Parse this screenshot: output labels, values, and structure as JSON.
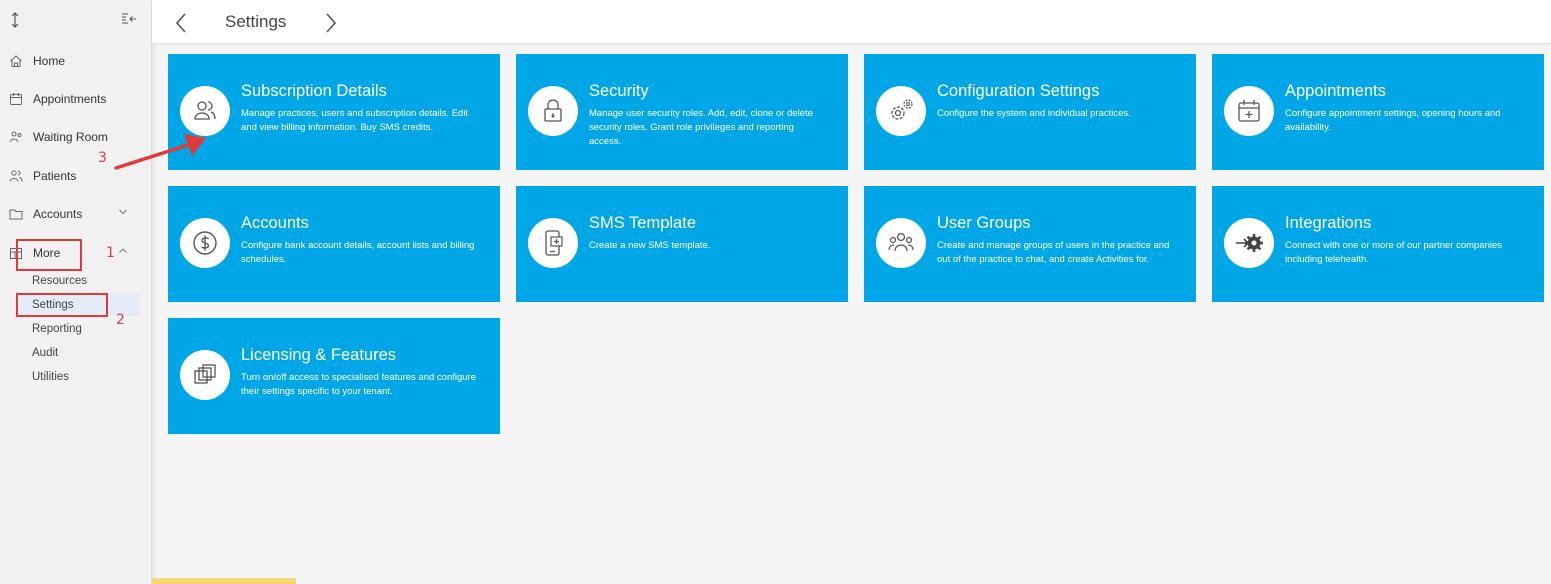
{
  "header": {
    "title": "Settings"
  },
  "sidebar": {
    "items": [
      {
        "label": "Home"
      },
      {
        "label": "Appointments"
      },
      {
        "label": "Waiting Room"
      },
      {
        "label": "Patients"
      },
      {
        "label": "Accounts"
      },
      {
        "label": "More"
      }
    ],
    "subitems": [
      {
        "label": "Resources"
      },
      {
        "label": "Settings"
      },
      {
        "label": "Reporting"
      },
      {
        "label": "Audit"
      },
      {
        "label": "Utilities"
      }
    ]
  },
  "annotations": {
    "n1": "1",
    "n2": "2",
    "n3": "3"
  },
  "tiles": [
    {
      "title": "Subscription Details",
      "desc": "Manage practices, users and subscription details. Edit and view billing information. Buy SMS credits.",
      "icon": "users-icon"
    },
    {
      "title": "Security",
      "desc": "Manage user security roles. Add, edit, clone or delete security roles. Grant role privileges and reporting access.",
      "icon": "lock-icon"
    },
    {
      "title": "Configuration Settings",
      "desc": "Configure the system and individual practices.",
      "icon": "gears-icon"
    },
    {
      "title": "Appointments",
      "desc": "Configure appointment settings, opening hours and availability.",
      "icon": "calendar-plus-icon"
    },
    {
      "title": "Accounts",
      "desc": "Configure bank account details, account lists and billing schedules.",
      "icon": "dollar-icon"
    },
    {
      "title": "SMS Template",
      "desc": "Create a new SMS template.",
      "icon": "phone-message-icon"
    },
    {
      "title": "User Groups",
      "desc": "Create and manage groups of users in the practice and out of the practice to chat, and create Activities for.",
      "icon": "user-group-icon"
    },
    {
      "title": "Integrations",
      "desc": "Connect with one or more of our partner companies including telehealth.",
      "icon": "integration-gear-icon"
    },
    {
      "title": "Licensing & Features",
      "desc": "Turn on/off access to specialised features and configure their settings specific to your tenant.",
      "icon": "layers-icon"
    }
  ],
  "colors": {
    "tile": "#00a6e6",
    "annotation": "#e03b3b"
  }
}
